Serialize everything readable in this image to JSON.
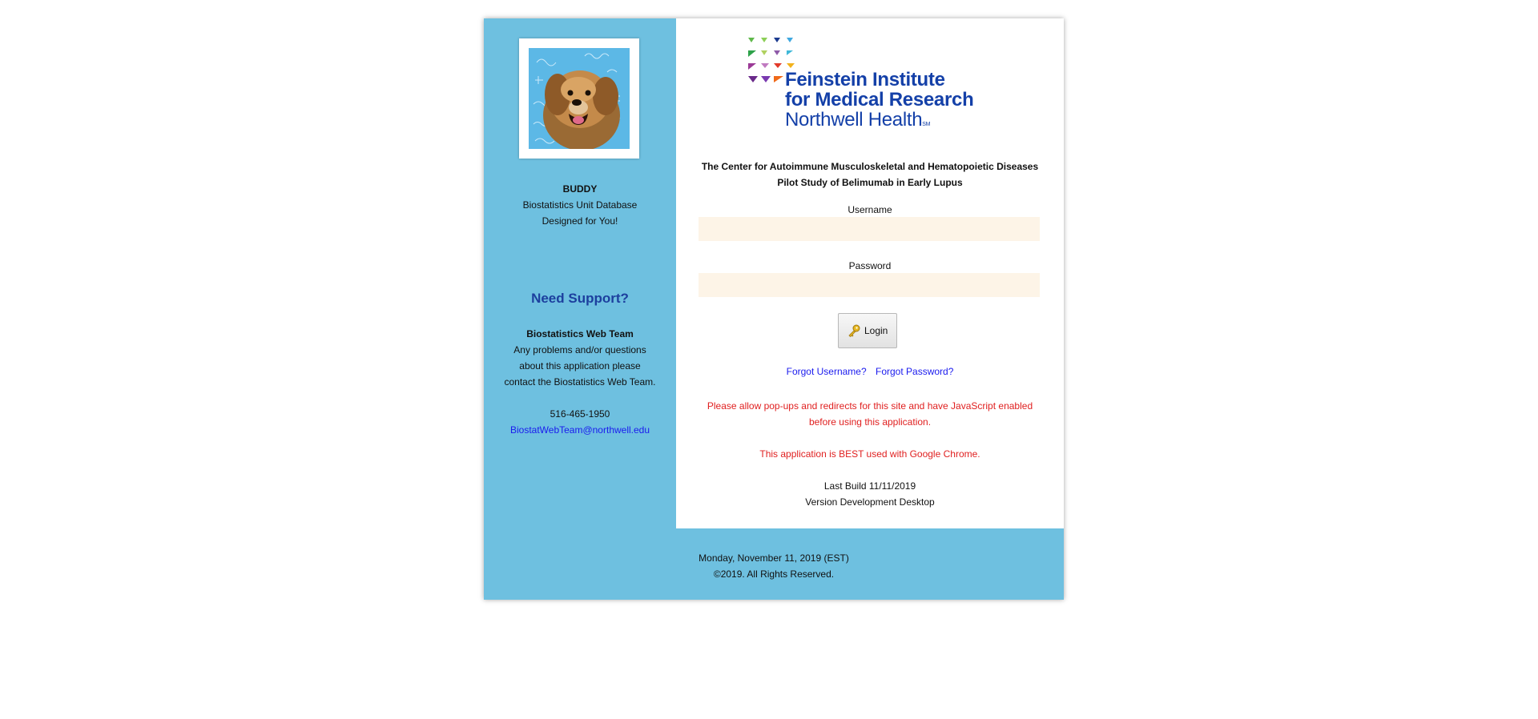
{
  "sidebar": {
    "app_name": "BUDDY",
    "tagline_1": "Biostatistics Unit Database",
    "tagline_2": "Designed for You!",
    "support_title": "Need Support?",
    "team_name": "Biostatistics Web Team",
    "support_text_1": "Any problems and/or questions",
    "support_text_2": "about this application please",
    "support_text_3": "contact the Biostatistics Web Team.",
    "phone": "516-465-1950",
    "email": "BiostatWebTeam@northwell.edu"
  },
  "logo": {
    "line1": "Feinstein Institute",
    "line2": "for Medical Research",
    "line3": "Northwell Health",
    "mark": "SM"
  },
  "header": {
    "center_name": "The Center for Autoimmune Musculoskeletal and Hematopoietic Diseases",
    "study_name": "Pilot Study of Belimumab in Early Lupus"
  },
  "form": {
    "username_label": "Username",
    "username_value": "",
    "password_label": "Password",
    "password_value": "",
    "login_label": "Login"
  },
  "links": {
    "forgot_username": "Forgot Username?",
    "forgot_password": "Forgot Password?"
  },
  "notices": {
    "popup_line1": "Please allow pop-ups and redirects for this site and have JavaScript enabled",
    "popup_line2": "before using this application.",
    "browser": "This application is BEST used with Google Chrome."
  },
  "build": {
    "last_build": "Last Build 11/11/2019",
    "version": "Version Development Desktop"
  },
  "footer": {
    "date": "Monday, November 11, 2019 (EST)",
    "copyright": "©2019. All Rights Reserved."
  },
  "colors": {
    "sidebar_bg": "#6ec0e0",
    "brand_blue": "#1440a8",
    "link_blue": "#1a1aee",
    "warning_red": "#e02020",
    "input_bg": "#fdf4e7"
  },
  "icons": {
    "login": "key-icon",
    "photo": "dog-photo"
  }
}
